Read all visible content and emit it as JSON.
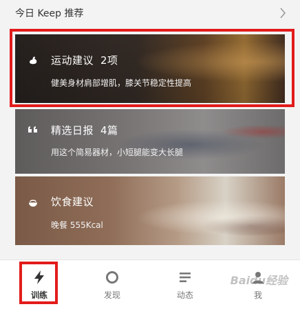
{
  "header": {
    "title": "今日 Keep 推荐"
  },
  "cards": [
    {
      "title": "运动建议",
      "count": "2项",
      "subtitle": "健美身材肩部增肌，膝关节稳定性提高",
      "icon": "flexed-arm-icon",
      "color": "#2a2420"
    },
    {
      "title": "精选日报",
      "count": "4篇",
      "subtitle": "用这个简易器材，小短腿能变大长腿",
      "icon": "quote-icon",
      "color": "#6d6b6b"
    },
    {
      "title": "饮食建议",
      "count": "",
      "subtitle": "晚餐 555Kcal",
      "icon": "bowl-icon",
      "color": "#8a6a57"
    }
  ],
  "tabbar": {
    "items": [
      {
        "label": "训练",
        "icon": "lightning-icon",
        "active": true
      },
      {
        "label": "发现",
        "icon": "discover-ring-icon",
        "active": false
      },
      {
        "label": "动态",
        "icon": "feed-lines-icon",
        "active": false
      },
      {
        "label": "我",
        "icon": "person-icon",
        "active": false
      }
    ]
  },
  "watermark": {
    "text": "Baidu经验"
  },
  "colors": {
    "highlight": "#e21b1b",
    "background": "#f3f3f3"
  }
}
